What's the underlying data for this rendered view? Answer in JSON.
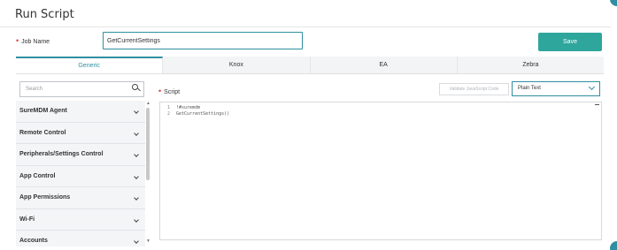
{
  "header": {
    "title": "Run Script"
  },
  "form": {
    "job_name_label": "Job Name",
    "job_name_value": "GetCurrentSettings",
    "save_label": "Save"
  },
  "tabs": [
    {
      "label": "Generic",
      "active": true
    },
    {
      "label": "Knox",
      "active": false
    },
    {
      "label": "EA",
      "active": false
    },
    {
      "label": "Zebra",
      "active": false
    }
  ],
  "sidebar": {
    "search_placeholder": "Search",
    "items": [
      {
        "label": "SureMDM Agent"
      },
      {
        "label": "Remote Control"
      },
      {
        "label": "Peripherals/Settings Control"
      },
      {
        "label": "App Control"
      },
      {
        "label": "App Permissions"
      },
      {
        "label": "Wi-Fi"
      },
      {
        "label": "Accounts"
      }
    ]
  },
  "script": {
    "label": "Script",
    "validate_label": "Validate JavaScript Code",
    "language_selected": "Plain Text",
    "lines": [
      {
        "num": "1",
        "text": "!#suremdm"
      },
      {
        "num": "2",
        "text": "GetCurrentSettings()"
      }
    ]
  },
  "colors": {
    "accent": "#2f8fa0",
    "save_button": "#2fa69c",
    "required": "#e23b3b"
  }
}
